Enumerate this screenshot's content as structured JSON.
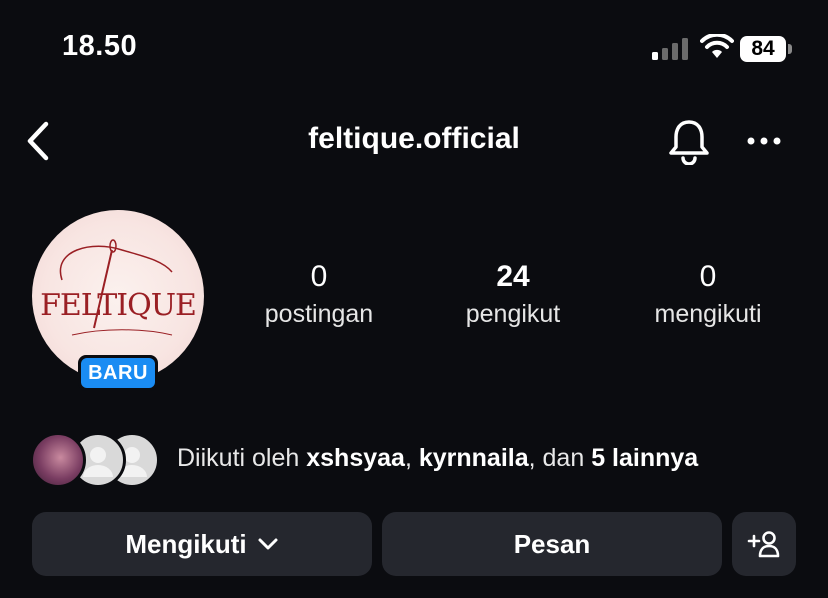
{
  "status_bar": {
    "time": "18.50",
    "battery": "84"
  },
  "header": {
    "username": "feltique.official",
    "icons": [
      "back-chevron-icon",
      "bell-icon",
      "more-horizontal-icon"
    ]
  },
  "profile": {
    "avatar_logo_text": "FELTIQUE",
    "badge": "BARU",
    "stats": [
      {
        "value": "0",
        "label": "postingan"
      },
      {
        "value": "24",
        "label": "pengikut"
      },
      {
        "value": "0",
        "label": "mengikuti"
      }
    ]
  },
  "followed_by": {
    "prefix": "Diikuti oleh",
    "user1": "xshsyaa",
    "sep": ",",
    "user2": "kyrnnaila",
    "and": ", dan",
    "others": "5 lainnya"
  },
  "actions": {
    "follow_label": "Mengikuti",
    "message_label": "Pesan"
  },
  "colors": {
    "background": "#0b0c10",
    "button": "#25272e",
    "badge": "#1a8cf3",
    "logo": "#9a1f24"
  }
}
